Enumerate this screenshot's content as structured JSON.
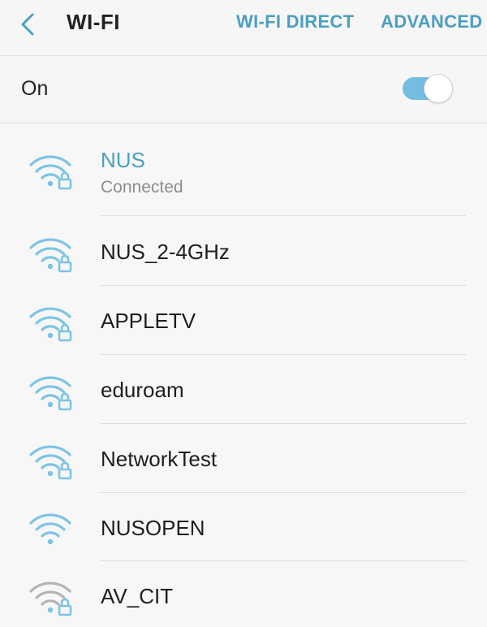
{
  "header": {
    "title": "WI-FI",
    "wifi_direct_label": "WI-FI DIRECT",
    "advanced_label": "ADVANCED"
  },
  "toggle": {
    "label": "On",
    "state": "on"
  },
  "colors": {
    "accent": "#4a9fc4",
    "icon_active": "#7cc3e6",
    "icon_weak": "#b3b3b3",
    "switch_track": "#74bde0"
  },
  "networks": [
    {
      "ssid": "NUS",
      "status": "Connected",
      "secured": true,
      "signal": "strong",
      "icon": "wifi-lock-icon"
    },
    {
      "ssid": "NUS_2-4GHz",
      "status": "",
      "secured": true,
      "signal": "strong",
      "icon": "wifi-lock-icon"
    },
    {
      "ssid": "APPLETV",
      "status": "",
      "secured": true,
      "signal": "strong",
      "icon": "wifi-lock-icon"
    },
    {
      "ssid": "eduroam",
      "status": "",
      "secured": true,
      "signal": "strong",
      "icon": "wifi-lock-icon"
    },
    {
      "ssid": "NetworkTest",
      "status": "",
      "secured": true,
      "signal": "strong",
      "icon": "wifi-lock-icon"
    },
    {
      "ssid": "NUSOPEN",
      "status": "",
      "secured": false,
      "signal": "strong",
      "icon": "wifi-icon"
    },
    {
      "ssid": "AV_CIT",
      "status": "",
      "secured": true,
      "signal": "weak",
      "icon": "wifi-lock-icon"
    }
  ]
}
